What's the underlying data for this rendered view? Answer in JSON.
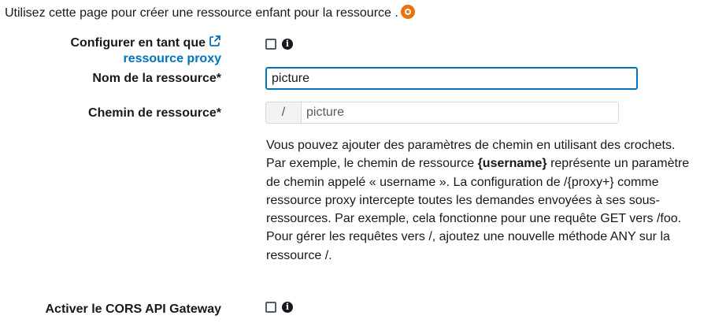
{
  "intro": {
    "text": "Utilisez cette page pour créer une ressource enfant pour la ressource ."
  },
  "proxy": {
    "label_line1": "Configurer en tant que",
    "label_line2": "ressource proxy"
  },
  "resource_name": {
    "label": "Nom de la ressource*",
    "value": "picture"
  },
  "resource_path": {
    "label": "Chemin de ressource*",
    "prefix": "/",
    "value": "picture"
  },
  "help": {
    "part1": "Vous pouvez ajouter des paramètres de chemin en utilisant des crochets. Par exemple, le chemin de ressource ",
    "bold": "{username}",
    "part2": " représente un paramètre de chemin appelé « username ». La configuration de /{proxy+} comme ressource proxy intercepte toutes les demandes envoyées à ses sous-ressources. Par exemple, cela fonctionne pour une requête GET vers /foo. Pour gérer les requêtes vers /, ajoutez une nouvelle méthode ANY sur la ressource /."
  },
  "cors": {
    "label": "Activer le CORS API Gateway"
  },
  "icons": {
    "info": "info-icon",
    "external_link": "external-link-icon",
    "status_dot": "status-dot-icon"
  },
  "colors": {
    "accent": "#ec7211",
    "link": "#0073bb",
    "focus": "#0073bb"
  }
}
